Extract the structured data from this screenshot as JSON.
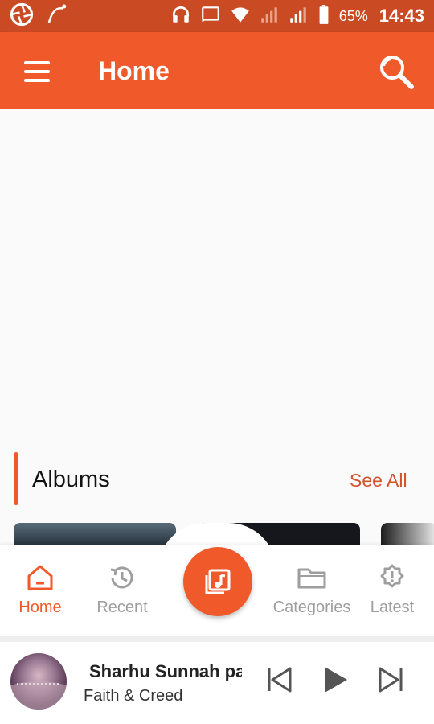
{
  "statusbar": {
    "battery": "65%",
    "time": "14:43"
  },
  "appbar": {
    "title": "Home"
  },
  "albums": {
    "title": "Albums",
    "see_all": "See All"
  },
  "nav": {
    "items": [
      {
        "label": "Home"
      },
      {
        "label": "Recent"
      },
      {
        "label": "Categories"
      },
      {
        "label": "Latest"
      }
    ]
  },
  "player": {
    "title": "Sharhu Sunnah pa",
    "subtitle": "Faith & Creed"
  },
  "colors": {
    "accent": "#f05a2b",
    "statusbar": "#c94a23"
  }
}
